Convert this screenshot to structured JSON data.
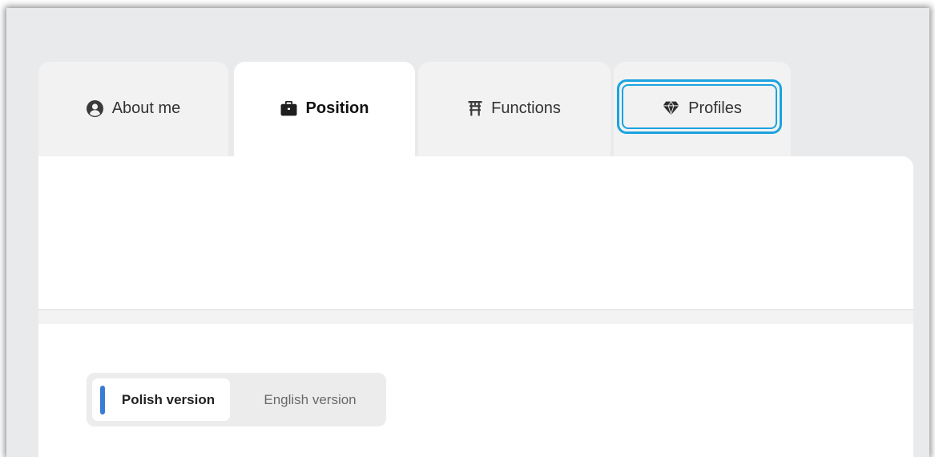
{
  "tabs": {
    "about": {
      "label": "About me",
      "icon": "user-circle-icon"
    },
    "position": {
      "label": "Position",
      "icon": "briefcase-icon"
    },
    "functions": {
      "label": "Functions",
      "icon": "torii-gate-icon"
    },
    "profiles": {
      "label": "Profiles",
      "icon": "gem-icon"
    },
    "active": "Position",
    "focused": "Profiles"
  },
  "language_toggle": {
    "polish": "Polish version",
    "english": "English version",
    "selected": "Polish version"
  },
  "colors": {
    "accent": "#3a7bd5",
    "focus_ring": "#1aa3e0",
    "background": "#e9eaeb"
  }
}
